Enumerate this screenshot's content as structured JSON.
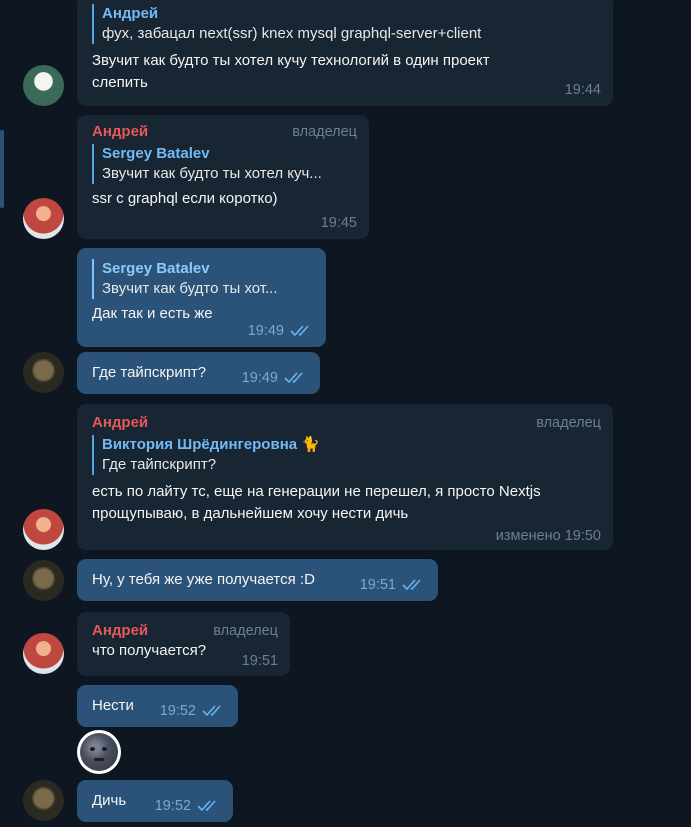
{
  "messages": [
    {
      "id": "m1",
      "reply_name": "Андрей",
      "reply_text": "фух, забацал next(ssr) knex mysql graphql-server+client",
      "text1": "Звучит как будто ты хотел кучу технологий в один проект",
      "text2": "слепить",
      "time": "19:44"
    },
    {
      "id": "m2",
      "sender": "Андрей",
      "role": "владелец",
      "reply_name": "Sergey Batalev",
      "reply_text": "Звучит как будто ты хотел куч...",
      "text": "ssr с graphql если коротко)",
      "time": "19:45"
    },
    {
      "id": "m3",
      "reply_name": "Sergey Batalev",
      "reply_text": "Звучит как будто ты хот...",
      "text": "Дак так и есть же",
      "time": "19:49"
    },
    {
      "id": "m4",
      "text": "Где тайпскрипт?",
      "time": "19:49"
    },
    {
      "id": "m5",
      "sender": "Андрей",
      "role": "владелец",
      "reply_name": "Виктория Шрёдингеровна 🐈",
      "reply_text": "Где тайпскрипт?",
      "text1": "есть по лайту тс, еще на генерации не перешел, я просто Nextjs",
      "text2": "прощупываю, в дальнейшем хочу нести дичь",
      "time": "изменено 19:50"
    },
    {
      "id": "m6",
      "text": "Ну, у тебя же уже получается :D",
      "time": "19:51"
    },
    {
      "id": "m7",
      "sender": "Андрей",
      "role": "владелец",
      "text": "что получается?",
      "time": "19:51"
    },
    {
      "id": "m8",
      "text": "Нести",
      "time": "19:52"
    },
    {
      "id": "m9",
      "text": "Дичь",
      "time": "19:52"
    }
  ],
  "colors": {
    "background": "#0e1621",
    "incoming_bubble": "#182533",
    "outgoing_bubble": "#2b5278",
    "sender_name": "#e5575a",
    "reply_accent": "#71baf5"
  },
  "icons": [
    "double-check-icon",
    "moon-face-sticker"
  ]
}
